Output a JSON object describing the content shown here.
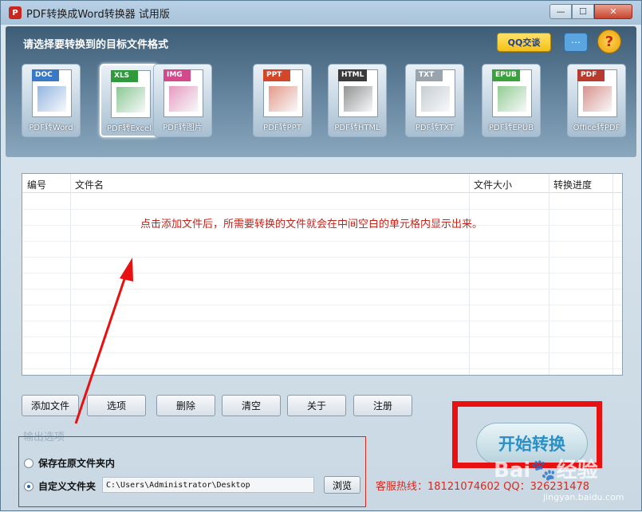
{
  "window": {
    "title": "PDF转换成Word转换器 试用版",
    "min_icon": "—",
    "max_icon": "☐",
    "close_icon": "✕"
  },
  "header": {
    "label": "请选择要转换到的目标文件格式",
    "qq_label": "QQ交谈",
    "help_glyph": "?"
  },
  "formats": [
    {
      "tag": "DOC",
      "label": "PDF转Word",
      "color": "#3a78c8",
      "active": false
    },
    {
      "tag": "XLS",
      "label": "PDF转Excel",
      "color": "#2e9a3c",
      "active": true
    },
    {
      "tag": "IMG",
      "label": "PDF转图片",
      "color": "#d24a8c",
      "active": false
    },
    {
      "tag": "PPT",
      "label": "PDF转PPT",
      "color": "#d2462a",
      "active": false
    },
    {
      "tag": "HTML",
      "label": "PDF转HTML",
      "color": "#3a3a3a",
      "active": false
    },
    {
      "tag": "TXT",
      "label": "PDF转TXT",
      "color": "#9aa4ad",
      "active": false
    },
    {
      "tag": "EPUB",
      "label": "PDF转EPUB",
      "color": "#3aa23a",
      "active": false
    },
    {
      "tag": "PDF",
      "label": "Office转PDF",
      "color": "#b93a2e",
      "active": false
    }
  ],
  "file_list": {
    "columns": [
      "编号",
      "文件名",
      "文件大小",
      "转换进度"
    ],
    "rows": [],
    "hint": "点击添加文件后，所需要转换的文件就会在中间空白的单元格内显示出来。"
  },
  "actions": {
    "add": "添加文件",
    "options": "选项",
    "delete": "删除",
    "clear": "清空",
    "about": "关于",
    "register": "注册"
  },
  "output": {
    "label": "输出选项",
    "option_original": "保存在原文件夹内",
    "option_custom": "自定义文件夹",
    "selected": "custom",
    "path": "C:\\Users\\Administrator\\Desktop",
    "browse": "浏览"
  },
  "start_button": "开始转换",
  "hotline": "客服热线：18121074602 QQ：326231478",
  "watermark": {
    "text": "Bai🐾经验",
    "sub": "jingyan.baidu.com"
  },
  "colors": {
    "annotation_red": "#e81010",
    "hint_red": "#c0251c"
  }
}
